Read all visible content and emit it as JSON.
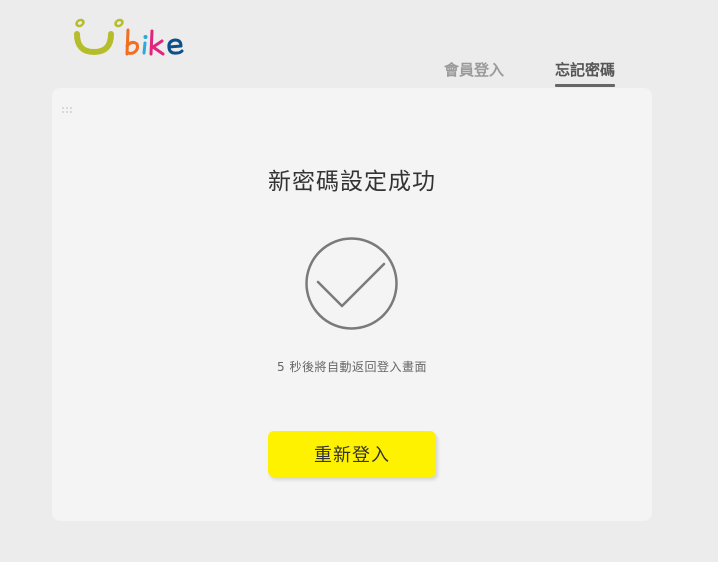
{
  "brand": {
    "logo_text": "Ubike",
    "colors": {
      "u": "#b6bd2b",
      "b": "#f26f21",
      "i": "#2aa9e0",
      "k": "#e2257b",
      "e": "#0d4f8b"
    }
  },
  "nav": {
    "tabs": [
      {
        "label": "會員登入",
        "active": false
      },
      {
        "label": "忘記密碼",
        "active": true
      }
    ]
  },
  "main": {
    "title": "新密碼設定成功",
    "status_icon": "check-circle-icon",
    "notice": "5 秒後將自動返回登入畫面",
    "button_label": "重新登入"
  },
  "colors": {
    "background": "#ececec",
    "card": "#f4f4f4",
    "button": "#fff200",
    "icon_stroke": "#7a7a7a"
  }
}
